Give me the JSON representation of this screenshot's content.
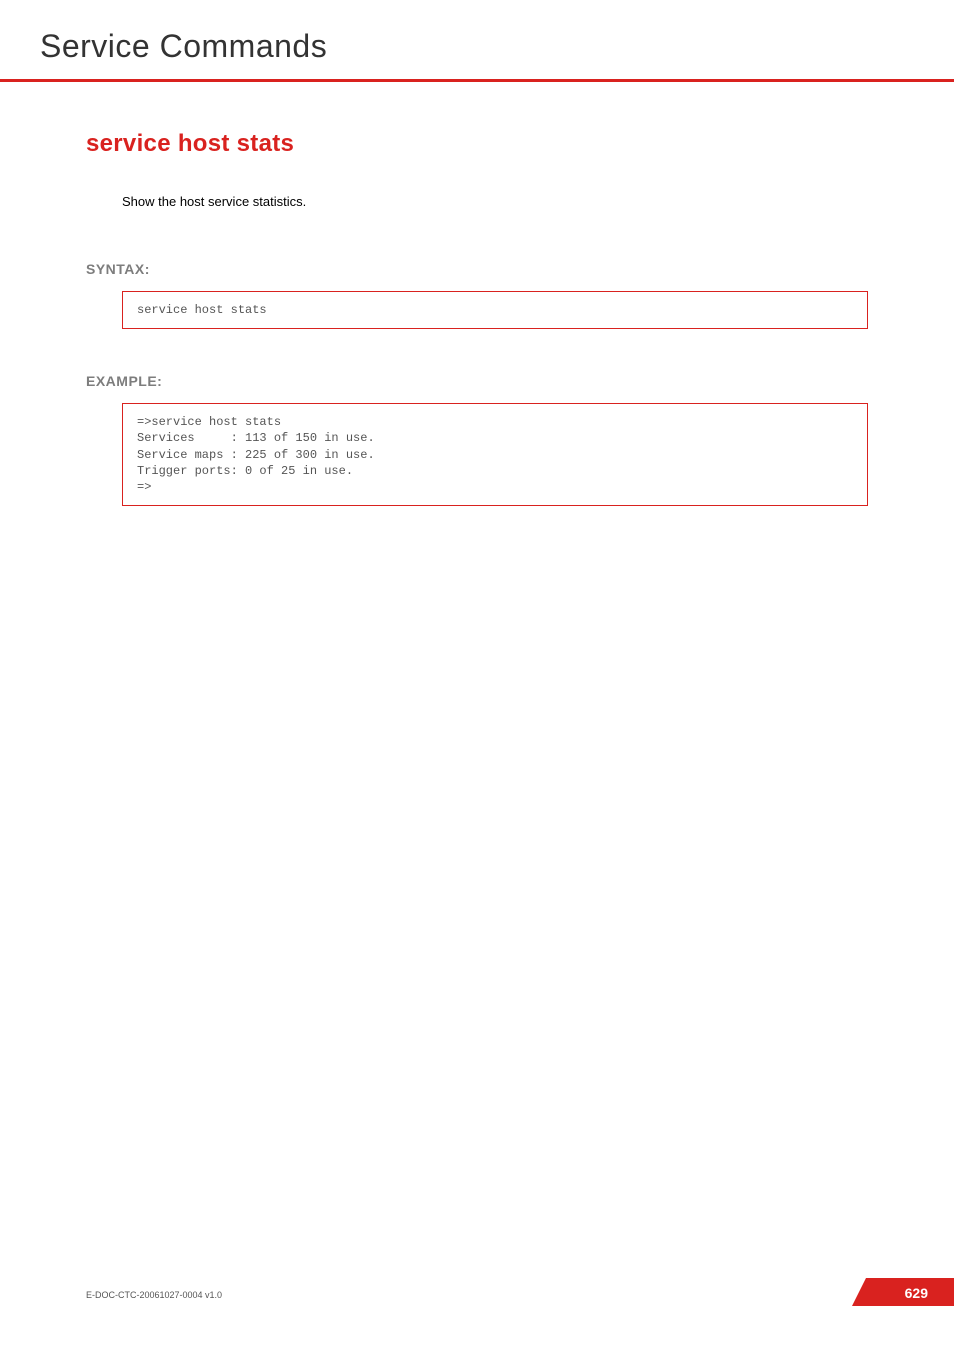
{
  "chapter_title": "Service Commands",
  "section_title": "service host stats",
  "description": "Show the host service statistics.",
  "syntax": {
    "heading": "SYNTAX:",
    "code": "service host stats"
  },
  "example": {
    "heading": "EXAMPLE:",
    "code": "=>service host stats\nServices     : 113 of 150 in use.\nService maps : 225 of 300 in use.\nTrigger ports: 0 of 25 in use.\n=>"
  },
  "footer": {
    "doc_id": "E-DOC-CTC-20061027-0004 v1.0",
    "page_number": "629"
  }
}
